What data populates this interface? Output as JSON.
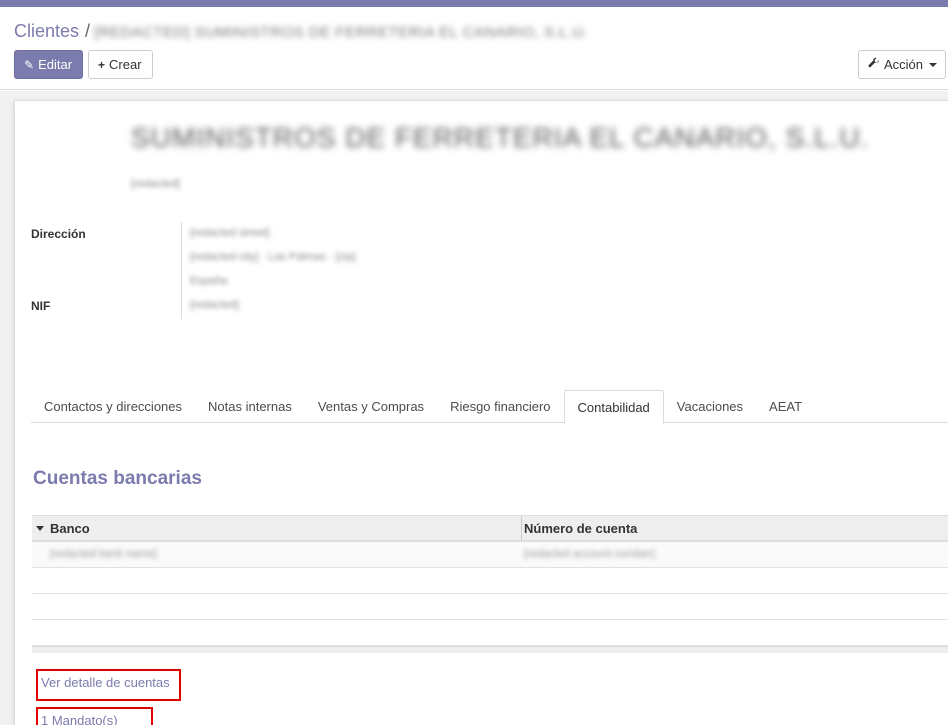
{
  "colors": {
    "primary": "#7c7bad",
    "highlight": "#e00000"
  },
  "breadcrumb": {
    "root": "Clientes",
    "separator": "/",
    "current": "[REDACTED] SUMINISTROS DE FERRETERIA EL CANARIO, S.L.U."
  },
  "toolbar": {
    "edit_label": "Editar",
    "edit_icon": "pencil-icon",
    "create_label": "Crear",
    "create_icon": "plus-icon",
    "action_label": "Acción",
    "action_icon": "wrench-icon"
  },
  "partner": {
    "name": "SUMINISTROS DE FERRETERIA EL CANARIO, S.L.U.",
    "subtitle": "[redacted]"
  },
  "fields": {
    "address_label": "Dirección",
    "address_lines": [
      "[redacted street]",
      "[redacted city] · Las Palmas · [zip]",
      "España"
    ],
    "nif_label": "NIF",
    "nif_value": "[redacted]"
  },
  "tabs": [
    "Contactos y direcciones",
    "Notas internas",
    "Ventas y Compras",
    "Riesgo financiero",
    "Contabilidad",
    "Vacaciones",
    "AEAT"
  ],
  "active_tab": "Contabilidad",
  "bank_section": {
    "title": "Cuentas bancarias",
    "columns": [
      "Banco",
      "Número de cuenta"
    ],
    "rows": [
      {
        "bank": "[redacted bank name]",
        "account": "[redacted account number]"
      }
    ]
  },
  "links": {
    "account_detail": "Ver detalle de cuentas",
    "mandates": "1 Mandato(s)"
  }
}
